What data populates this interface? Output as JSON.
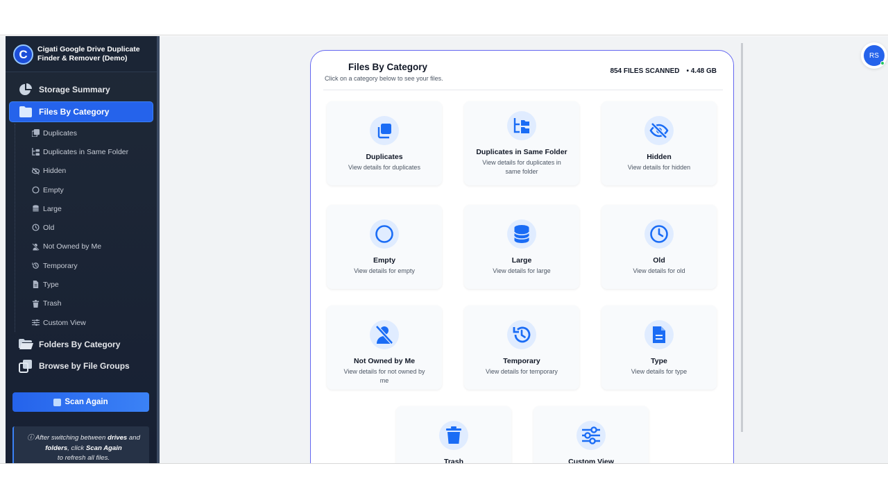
{
  "app": {
    "title": "Cigati Google Drive Duplicate Finder & Remover (Demo)",
    "logo_letter": "C"
  },
  "sidebar": {
    "main_items": [
      {
        "label": "Storage Summary",
        "icon": "pie-chart-icon"
      },
      {
        "label": "Files By Category",
        "icon": "folder-icon",
        "active": true
      },
      {
        "label": "Folders By Category",
        "icon": "folders-icon"
      },
      {
        "label": "Browse by File Groups",
        "icon": "copy-icon"
      }
    ],
    "sub_items": [
      {
        "label": "Duplicates",
        "icon": "duplicate-icon"
      },
      {
        "label": "Duplicates in Same Folder",
        "icon": "folder-tree-icon"
      },
      {
        "label": "Hidden",
        "icon": "eye-slash-icon"
      },
      {
        "label": "Empty",
        "icon": "circle-icon"
      },
      {
        "label": "Large",
        "icon": "database-icon"
      },
      {
        "label": "Old",
        "icon": "clock-icon"
      },
      {
        "label": "Not Owned by Me",
        "icon": "user-slash-icon"
      },
      {
        "label": "Temporary",
        "icon": "history-icon"
      },
      {
        "label": "Type",
        "icon": "file-icon"
      },
      {
        "label": "Trash",
        "icon": "trash-icon"
      },
      {
        "label": "Custom View",
        "icon": "sliders-icon"
      }
    ],
    "scan_button": "Scan Again",
    "note": {
      "p1": "After switching between",
      "b1": "drives",
      "p2": "and",
      "b2": "folders",
      "p3": ", click",
      "b3": "Scan Again",
      "p4": "to refresh all files."
    }
  },
  "card": {
    "title": "Files By Category",
    "subtitle": "Click on a category below to see your files.",
    "files_scanned": "854 FILES SCANNED",
    "size": "• 4.48 GB",
    "tiles": [
      {
        "title": "Duplicates",
        "desc": "View details for duplicates",
        "icon": "duplicate-icon"
      },
      {
        "title": "Duplicates in Same Folder",
        "desc": "View details for duplicates in same folder",
        "icon": "folder-tree-icon"
      },
      {
        "title": "Hidden",
        "desc": "View details for hidden",
        "icon": "eye-slash-icon"
      },
      {
        "title": "Empty",
        "desc": "View details for empty",
        "icon": "circle-icon"
      },
      {
        "title": "Large",
        "desc": "View details for large",
        "icon": "database-icon"
      },
      {
        "title": "Old",
        "desc": "View details for old",
        "icon": "clock-icon"
      },
      {
        "title": "Not Owned by Me",
        "desc": "View details for not owned by me",
        "icon": "user-slash-icon"
      },
      {
        "title": "Temporary",
        "desc": "View details for temporary",
        "icon": "history-icon"
      },
      {
        "title": "Type",
        "desc": "View details for type",
        "icon": "file-icon"
      },
      {
        "title": "Trash",
        "desc": "",
        "icon": "trash-icon"
      },
      {
        "title": "Custom View",
        "desc": "",
        "icon": "sliders-icon"
      }
    ]
  },
  "user": {
    "initials": "RS"
  },
  "colors": {
    "accent": "#2563eb",
    "sidebar_bg": "#1f2937",
    "icon_blue": "#1a6cf5"
  }
}
